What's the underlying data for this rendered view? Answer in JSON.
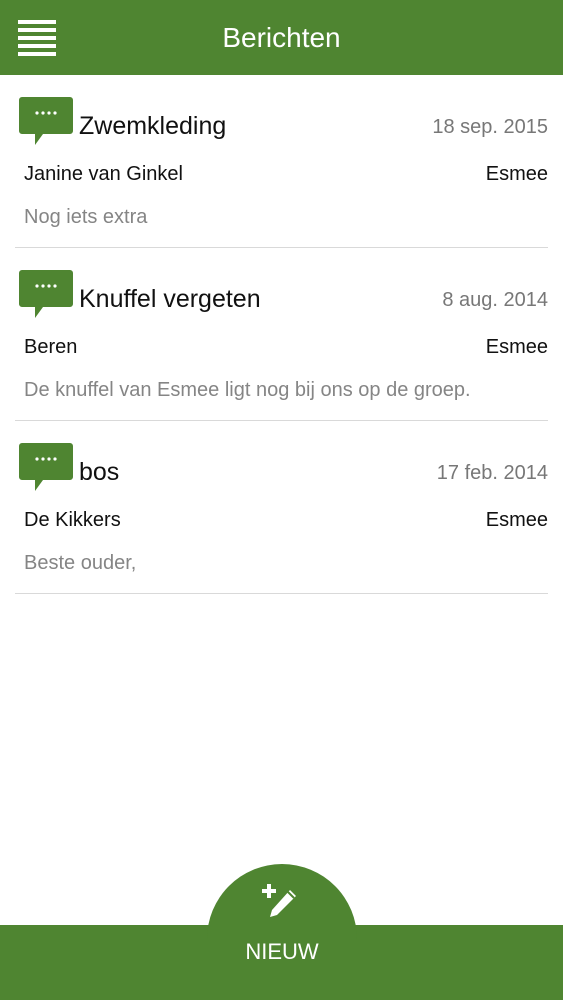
{
  "header": {
    "title": "Berichten"
  },
  "messages": [
    {
      "subject": "Zwemkleding",
      "date": "18 sep. 2015",
      "sender": "Janine van Ginkel",
      "recipient": "Esmee",
      "preview": "Nog iets extra"
    },
    {
      "subject": "Knuffel vergeten",
      "date": "8 aug. 2014",
      "sender": "Beren",
      "recipient": "Esmee",
      "preview": "De knuffel van Esmee ligt nog bij ons op de groep."
    },
    {
      "subject": "bos",
      "date": "17 feb. 2014",
      "sender": "De Kikkers",
      "recipient": "Esmee",
      "preview": "Beste ouder,"
    }
  ],
  "bottom": {
    "new_label": "NIEUW"
  },
  "colors": {
    "accent": "#4f8531"
  }
}
